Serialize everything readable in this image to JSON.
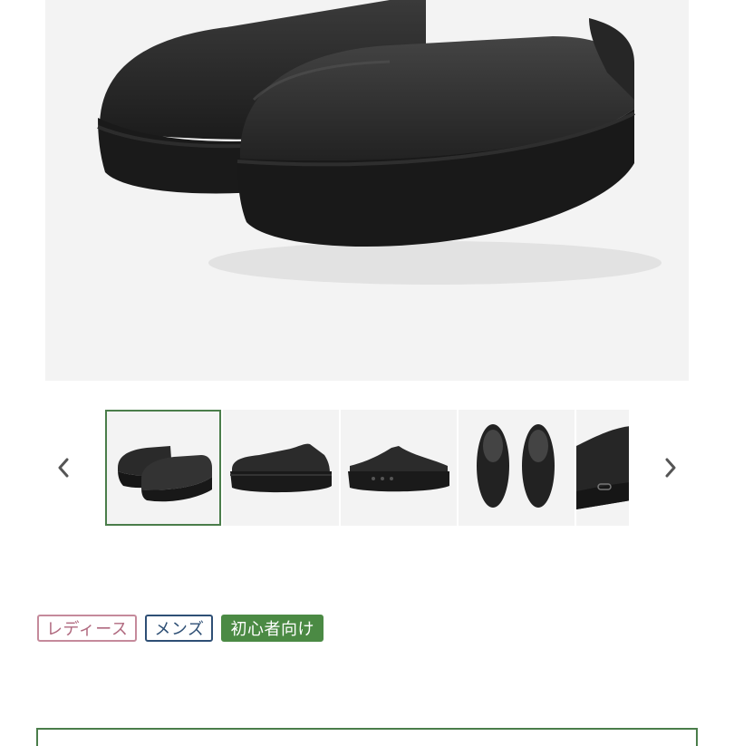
{
  "product": {
    "main_image_icon": "black-clog-shoe-photo"
  },
  "carousel": {
    "prev_icon": "chevron-left-icon",
    "next_icon": "chevron-right-icon",
    "thumbnails": [
      {
        "view": "pair-front-angle",
        "selected": true
      },
      {
        "view": "side-profile",
        "selected": false
      },
      {
        "view": "side-profile-vents",
        "selected": false
      },
      {
        "view": "top-down-pair",
        "selected": false
      },
      {
        "view": "heel-closeup",
        "selected": false
      }
    ]
  },
  "tags": {
    "ladies": "レディース",
    "mens": "メンズ",
    "beginner": "初心者向け"
  },
  "colors": {
    "accent_green": "#4a7d4a",
    "ladies_pink": "#c58a9b",
    "mens_navy": "#2e4f75",
    "beginner_green": "#4b8a44"
  }
}
